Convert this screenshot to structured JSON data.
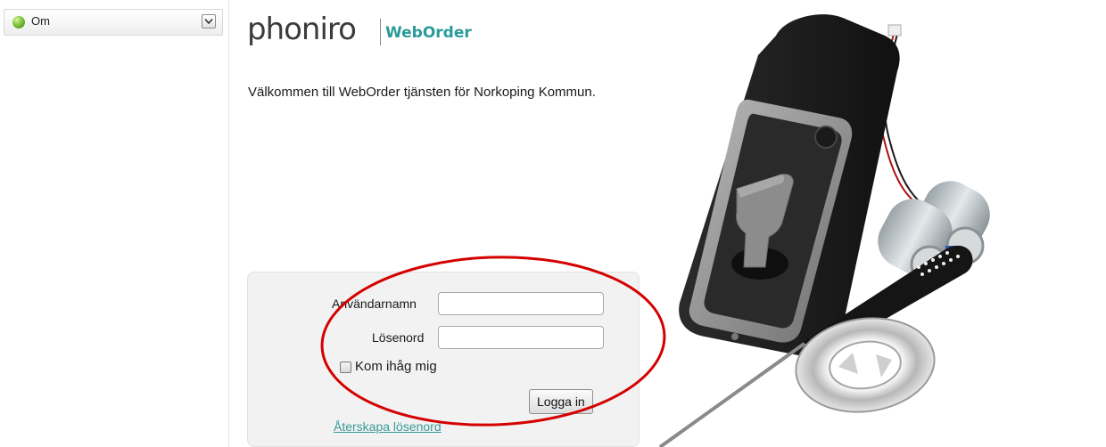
{
  "sidebar": {
    "header_label": "Om",
    "status_icon": "green-dot-icon",
    "dropdown_icon": "chevron-down-icon"
  },
  "logo": {
    "brand": "phoniro",
    "product": "WebOrder",
    "brand_color": "#3b3b3b",
    "product_color": "#2b9a9a"
  },
  "welcome_text": "Välkommen till WebOrder tjänsten för Norkoping Kommun.",
  "login": {
    "username_label": "Användarnamn",
    "username_value": "",
    "password_label": "Lösenord",
    "password_value": "",
    "remember_label": "Kom ihåg mig",
    "remember_checked": false,
    "submit_label": "Logga in",
    "recover_link": "Återskapa lösenord"
  },
  "annotation_color": "#d40000"
}
